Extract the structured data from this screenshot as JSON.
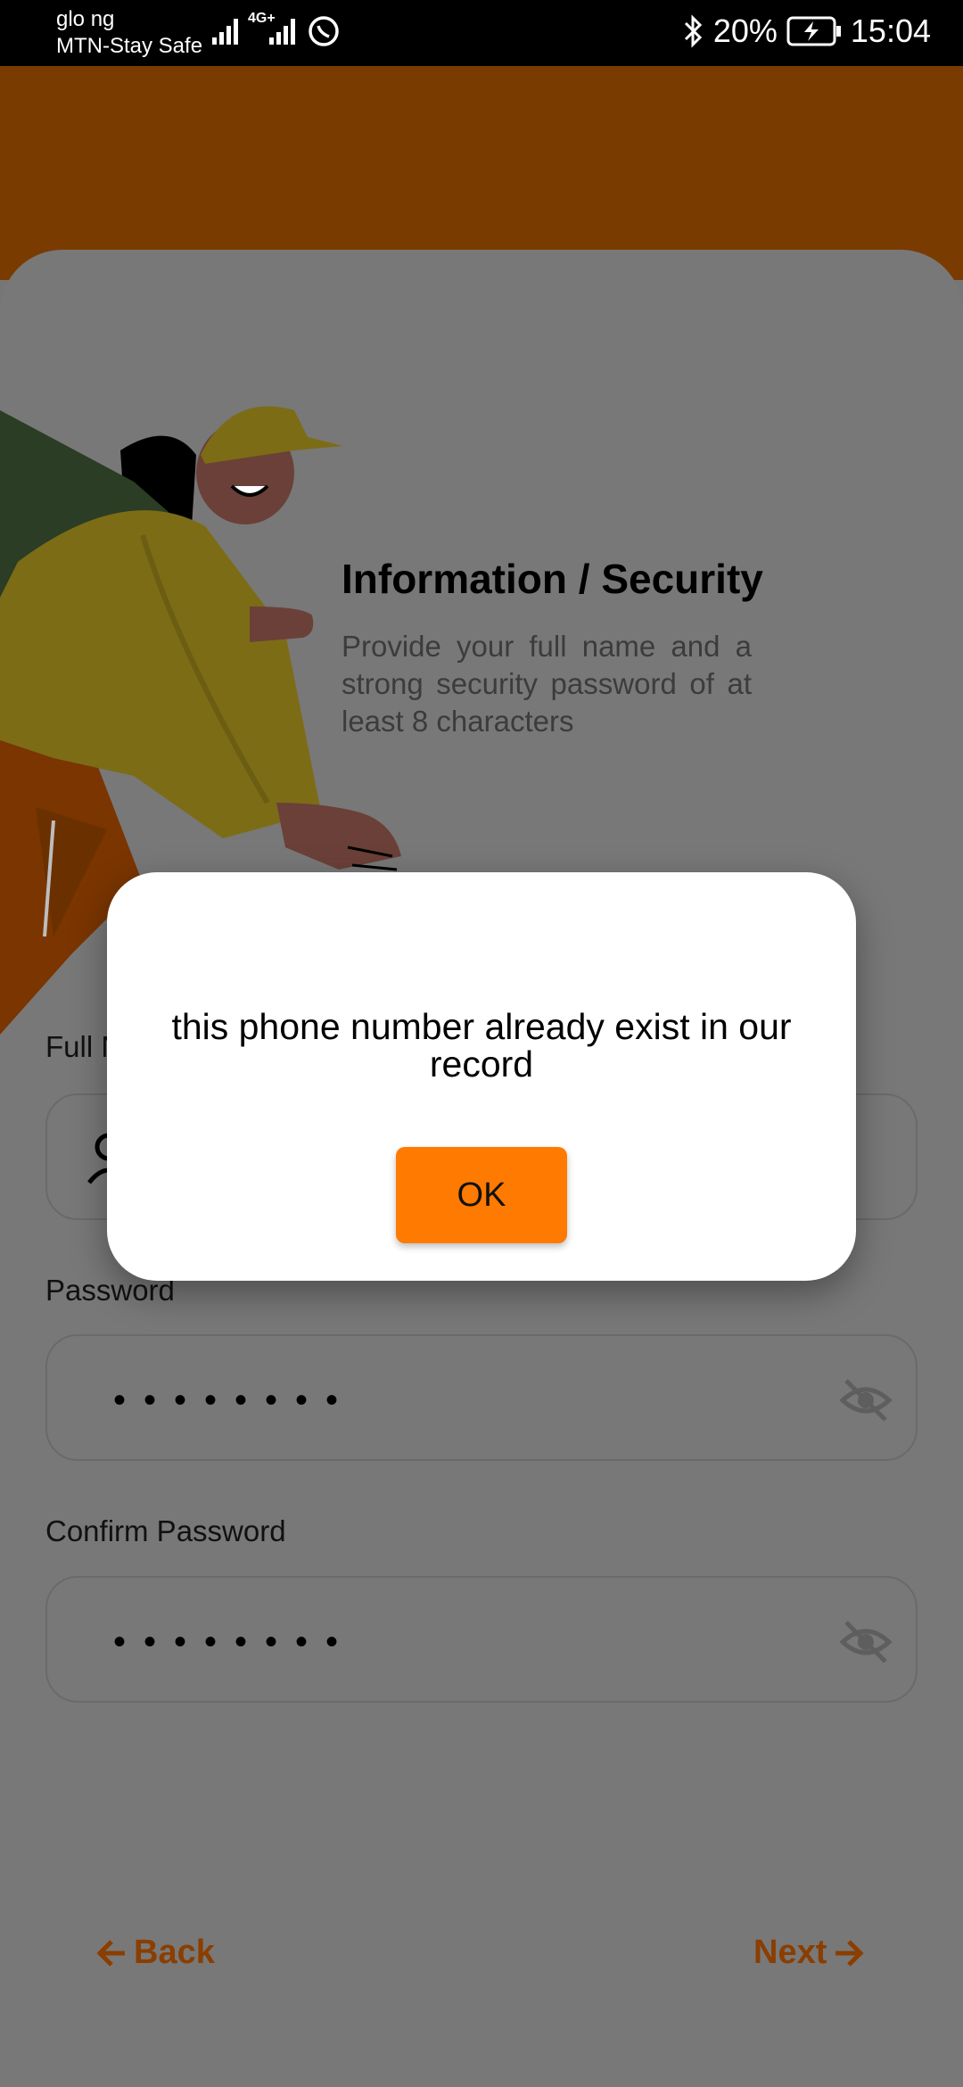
{
  "status_bar": {
    "carrier_1": "glo ng",
    "carrier_2": "MTN-Stay Safe",
    "network": "4G+",
    "battery": "20%",
    "time": "15:04"
  },
  "info": {
    "title": "Information / Security",
    "description": "Provide your full name and a strong security password of at least 8 characters"
  },
  "form": {
    "full_name_label": "Full Name",
    "password_label": "Password",
    "password_value": "••••••••",
    "confirm_password_label": "Confirm Password",
    "confirm_password_value": "••••••••"
  },
  "nav": {
    "back_label": "Back",
    "next_label": "Next"
  },
  "dialog": {
    "message": "this phone number already exist in our record",
    "ok_label": "OK"
  },
  "colors": {
    "accent": "#ff7a00",
    "header": "#7a3b00",
    "overlay_bg": "#767676"
  }
}
